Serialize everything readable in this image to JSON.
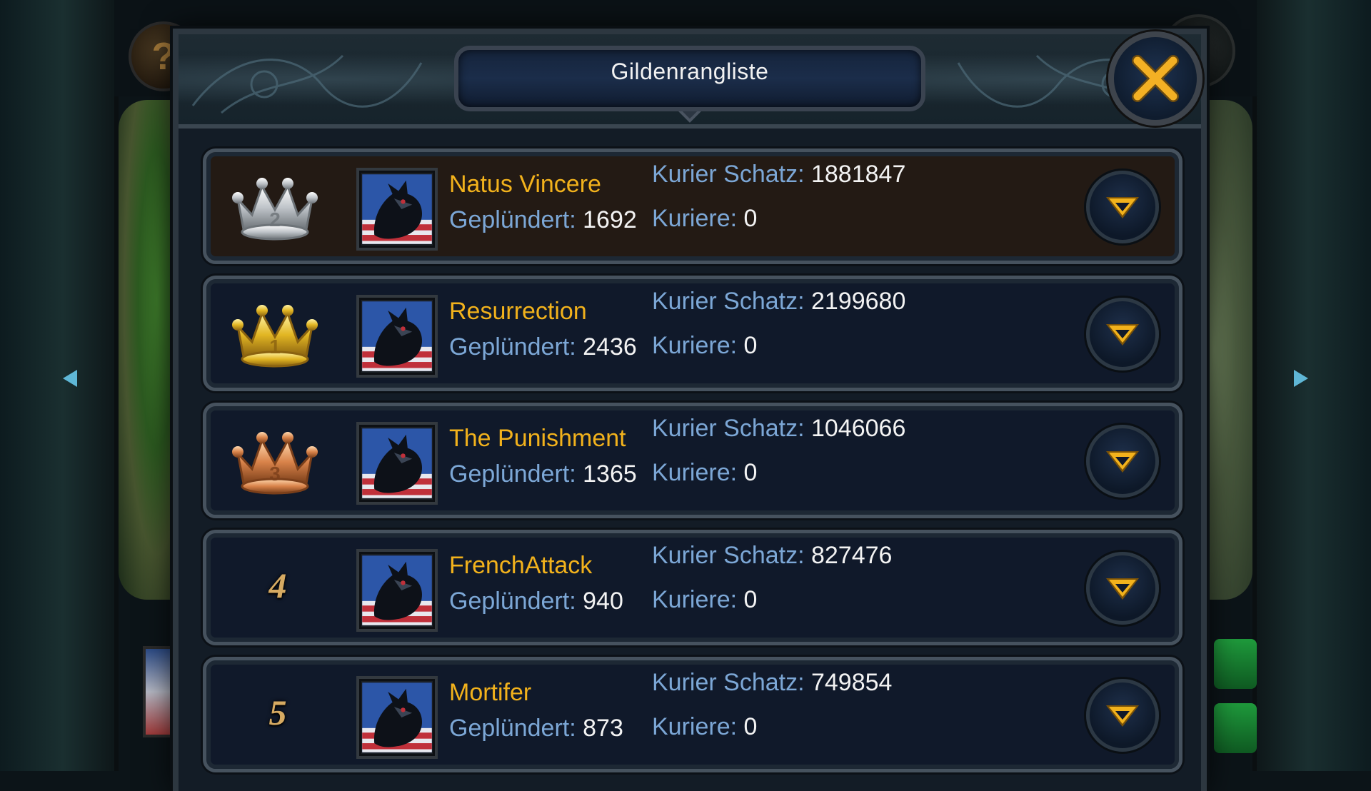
{
  "header": {
    "title": "Gildenrangliste",
    "close_icon": "close-x-icon"
  },
  "background": {
    "help_icon": "question-mark-icon",
    "help_glyph": "?",
    "map_icon": "scroll-map-icon",
    "nav_left_icon": "arrow-left-icon",
    "nav_right_icon": "arrow-right-icon"
  },
  "colors": {
    "accent_gold": "#f2b21c",
    "label_blue": "#7ca7d6",
    "value_white": "#f3f3f3",
    "highlight_row": "#231a14"
  },
  "rankings": [
    {
      "rank": "2",
      "rank_style": "silver-crown",
      "name": "Natus Vincere",
      "plunder_label": "Geplündert:",
      "plunder_value": "1692",
      "treasure_label": "Kurier Schatz:",
      "treasure_value": "1881847",
      "couriers_label": "Kuriere:",
      "couriers_value": "0",
      "highlighted": true
    },
    {
      "rank": "1",
      "rank_style": "gold-crown",
      "name": "Resurrection",
      "plunder_label": "Geplündert:",
      "plunder_value": "2436",
      "treasure_label": "Kurier Schatz:",
      "treasure_value": "2199680",
      "couriers_label": "Kuriere:",
      "couriers_value": "0",
      "highlighted": false
    },
    {
      "rank": "3",
      "rank_style": "bronze-crown",
      "name": "The Punishment",
      "plunder_label": "Geplündert:",
      "plunder_value": "1365",
      "treasure_label": "Kurier Schatz:",
      "treasure_value": "1046066",
      "couriers_label": "Kuriere:",
      "couriers_value": "0",
      "highlighted": false
    },
    {
      "rank": "4",
      "rank_style": "number",
      "name": "FrenchAttack",
      "plunder_label": "Geplündert:",
      "plunder_value": "940",
      "treasure_label": "Kurier Schatz:",
      "treasure_value": "827476",
      "couriers_label": "Kuriere:",
      "couriers_value": "0",
      "highlighted": false
    },
    {
      "rank": "5",
      "rank_style": "number",
      "name": "Mortifer",
      "plunder_label": "Geplündert:",
      "plunder_value": "873",
      "treasure_label": "Kurier Schatz:",
      "treasure_value": "749854",
      "couriers_label": "Kuriere:",
      "couriers_value": "0",
      "highlighted": false
    }
  ]
}
